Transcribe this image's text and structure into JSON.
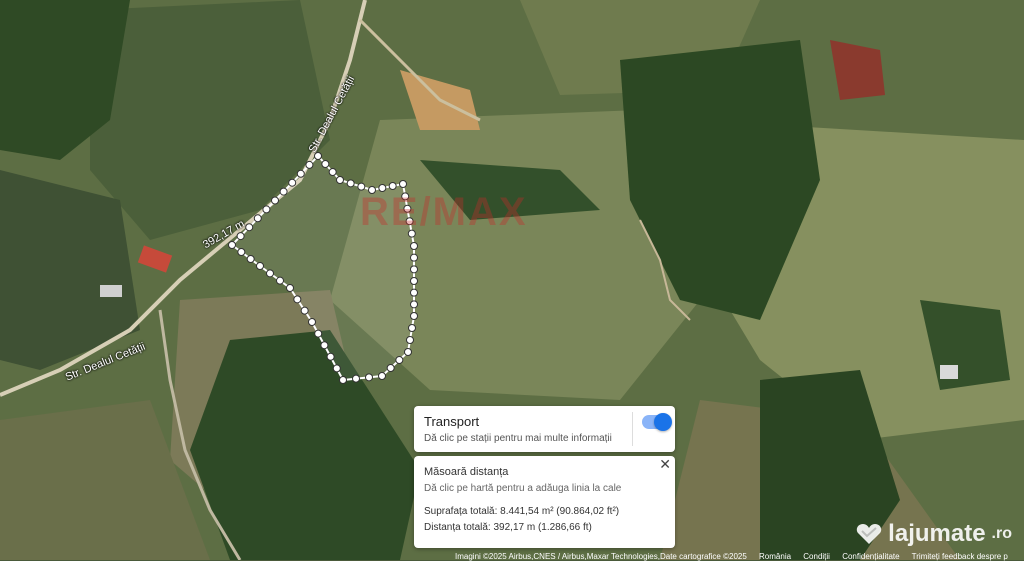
{
  "map": {
    "roads": [
      {
        "name": "Str. Dealul Cetății"
      },
      {
        "name": "Str. Dealul Cetății"
      }
    ],
    "segment_label": "392,17 m",
    "watermark": "RE/MAX"
  },
  "transport": {
    "title": "Transport",
    "subtitle": "Dă clic pe stații pentru mai multe informații",
    "toggle_on": true
  },
  "measure": {
    "title": "Măsoară distanța",
    "subtitle": "Dă clic pe hartă pentru a adăuga linia la cale",
    "total_area": "Suprafața totală: 8.441,54 m² (90.864,02 ft²)",
    "total_distance": "Distanța totală: 392,17 m (1.286,66 ft)",
    "close_glyph": "✕"
  },
  "footer": {
    "imagery": "Imagini ©2025 Airbus,CNES / Airbus,Maxar Technologies,Date cartografice ©2025",
    "country": "România",
    "terms": "Condiții",
    "privacy": "Confidențialitate",
    "feedback": "Trimiteți feedback despre p"
  },
  "brand": {
    "name": "lajumate",
    "suffix": ".ro"
  }
}
